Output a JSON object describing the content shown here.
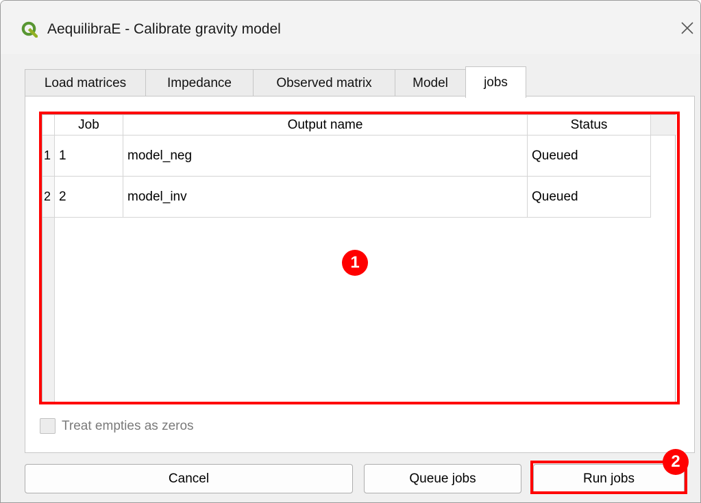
{
  "window": {
    "title": "AequilibraE - Calibrate gravity model",
    "icon": "qgis-logo-icon",
    "close_icon": "close-icon"
  },
  "tabs": [
    {
      "label": "Load matrices"
    },
    {
      "label": "Impedance"
    },
    {
      "label": "Observed matrix"
    },
    {
      "label": "Model"
    },
    {
      "label": "jobs",
      "active": true
    }
  ],
  "table": {
    "headers": [
      "Job",
      "Output name",
      "Status"
    ],
    "rows": [
      {
        "index": "1",
        "job": "1",
        "output": "model_neg",
        "status": "Queued"
      },
      {
        "index": "2",
        "job": "2",
        "output": "model_inv",
        "status": "Queued"
      }
    ]
  },
  "checkbox": {
    "label": "Treat empties as zeros",
    "checked": false,
    "enabled": false
  },
  "buttons": {
    "cancel": "Cancel",
    "queue": "Queue jobs",
    "run": "Run jobs"
  },
  "annotations": {
    "marker1": "1",
    "marker2": "2",
    "color": "#ff0000"
  }
}
